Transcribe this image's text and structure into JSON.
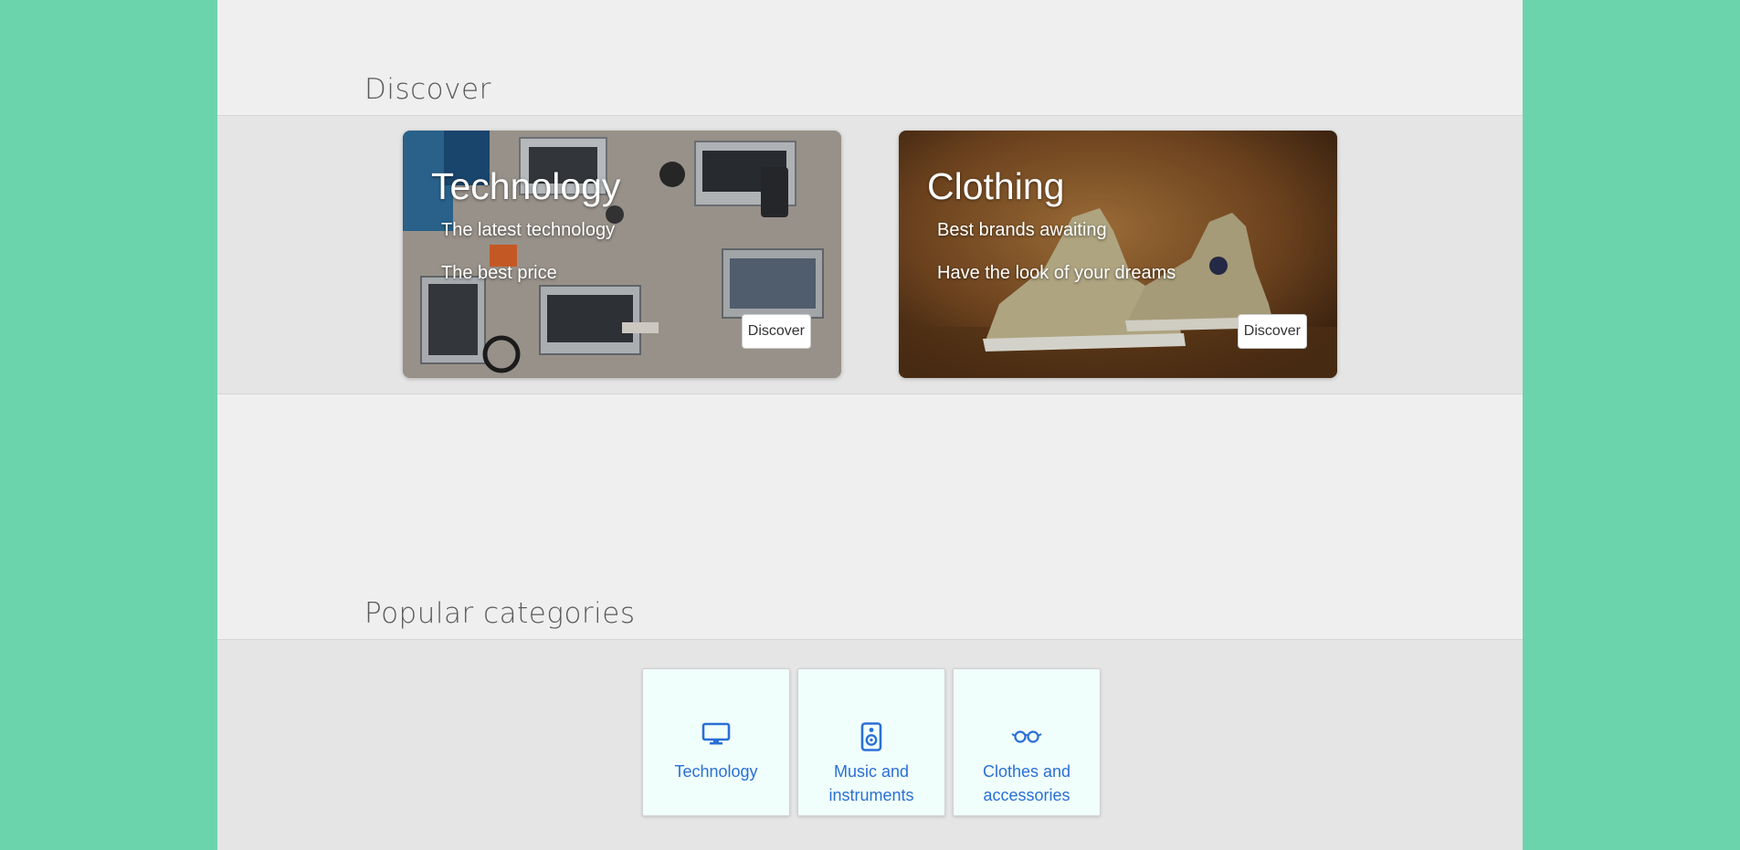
{
  "discover": {
    "title": "Discover",
    "cards": [
      {
        "title": "Technology",
        "line1": "The latest technology",
        "line2": "The best price",
        "button": "Discover"
      },
      {
        "title": "Clothing",
        "line1": "Best brands awaiting",
        "line2": "Have the look of your dreams",
        "button": "Discover"
      }
    ]
  },
  "popular": {
    "title": "Popular categories",
    "categories": [
      {
        "label": "Technology",
        "icon": "monitor-icon"
      },
      {
        "label": "Music and instruments",
        "icon": "speaker-icon"
      },
      {
        "label": "Clothes and accessories",
        "icon": "glasses-icon"
      }
    ]
  },
  "colors": {
    "page_background": "#6cd4ad",
    "content_background": "#efefef",
    "band_background": "#e5e5e5",
    "category_card": "#f0fffc",
    "accent": "#2a6fd6"
  }
}
